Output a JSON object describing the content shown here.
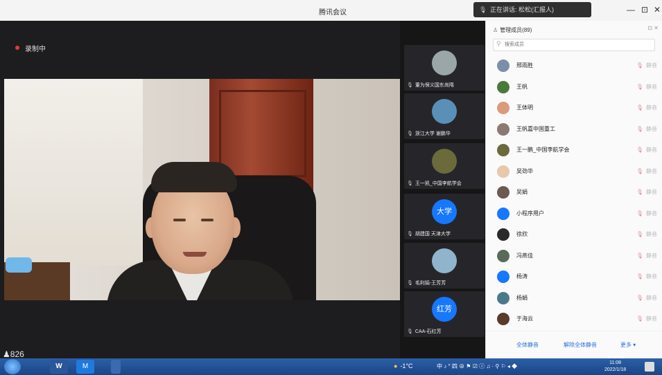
{
  "window": {
    "title": "腾讯会议",
    "speaking": "正在讲话: 松松(汇报人)",
    "controls": [
      "—",
      "⊡",
      "✕"
    ]
  },
  "stage": {
    "recording_label": "录制中",
    "participant_count": "826"
  },
  "thumbnails": [
    {
      "name": "董为保义国东尚隋",
      "avatar_text": "",
      "color": "#9aa6a8"
    },
    {
      "name": "浙江大学 谢鹏华",
      "avatar_text": "",
      "color": "#5a8fb8"
    },
    {
      "name": "王一凯_中国李航学会",
      "avatar_text": "",
      "color": "#6b6a3a"
    },
    {
      "name": "胡建国 天津大学",
      "avatar_text": "大学",
      "color": "#1677ff"
    },
    {
      "name": "毛利娟-王芳芳",
      "avatar_text": "",
      "color": "#8fb4cc"
    },
    {
      "name": "CAA-石红芳",
      "avatar_text": "红芳",
      "color": "#1677ff"
    }
  ],
  "members_panel": {
    "title": "管理成员(89)",
    "panel_controls": "⊡ ✕",
    "search_placeholder": "搜索成员",
    "members": [
      {
        "name": "邢雨胜",
        "avatar_color": "#7b8fa8"
      },
      {
        "name": "王帆",
        "avatar_color": "#4a7a3a"
      },
      {
        "name": "王体明",
        "avatar_color": "#d99b7a"
      },
      {
        "name": "王帆嘉中国重工",
        "avatar_color": "#8a7a70"
      },
      {
        "name": "王一鹏_中国李航学会",
        "avatar_color": "#6b6a3a"
      },
      {
        "name": "吴劲华",
        "avatar_color": "#e7c8a8"
      },
      {
        "name": "吴娟",
        "avatar_color": "#6a5a52"
      },
      {
        "name": "小程序用户",
        "avatar_color": "#1677ff"
      },
      {
        "name": "徐欣",
        "avatar_color": "#2a2a2a"
      },
      {
        "name": "冯燕佳",
        "avatar_color": "#5a6a5a"
      },
      {
        "name": "杨涛",
        "avatar_color": "#1677ff"
      },
      {
        "name": "杨娟",
        "avatar_color": "#4a7a8a"
      },
      {
        "name": "于海云",
        "avatar_color": "#5a3a2a"
      }
    ],
    "row_status": "静音",
    "actions": [
      "全体静音",
      "解除全体静音",
      "更多 ▾"
    ]
  },
  "taskbar": {
    "word_label": "W",
    "meeting_label": "M",
    "weather": "-1°C",
    "tray": "中 ♪ ° 四 ⊕ ⚑ ☑ ⓘ ♫ · ⚲ ⚐ ◂ ◆",
    "time": "11:08",
    "date": "2022/1/18"
  },
  "colors": {
    "accent": "#2f6fe0",
    "stage_bg": "#1d1d1f",
    "record_dot": "#e53935"
  }
}
